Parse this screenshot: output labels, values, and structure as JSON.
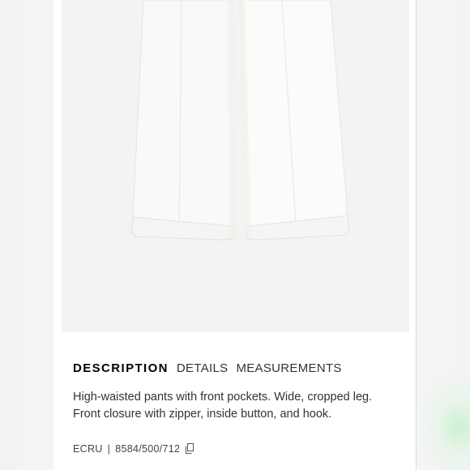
{
  "product": {
    "image_alt": "white wide-leg pants",
    "tabs": [
      {
        "label": "DESCRIPTION",
        "active": true
      },
      {
        "label": "DETAILS",
        "active": false
      },
      {
        "label": "MEASUREMENTS",
        "active": false
      }
    ],
    "description_line1": "High-waisted pants with front pockets. Wide, cropped leg.",
    "description_line2": "Front closure with zipper, inside button, and hook.",
    "color_name": "ECRU",
    "separator": "|",
    "reference": "8584/500/712",
    "copy_icon": "copy-icon"
  },
  "colors": {
    "page_bg": "#f5f5f5",
    "card_bg": "#ffffff",
    "photo_bg": "#f3f3f3",
    "garment": "#f9f9f7",
    "text_primary": "#000000",
    "text_secondary": "#333333"
  }
}
